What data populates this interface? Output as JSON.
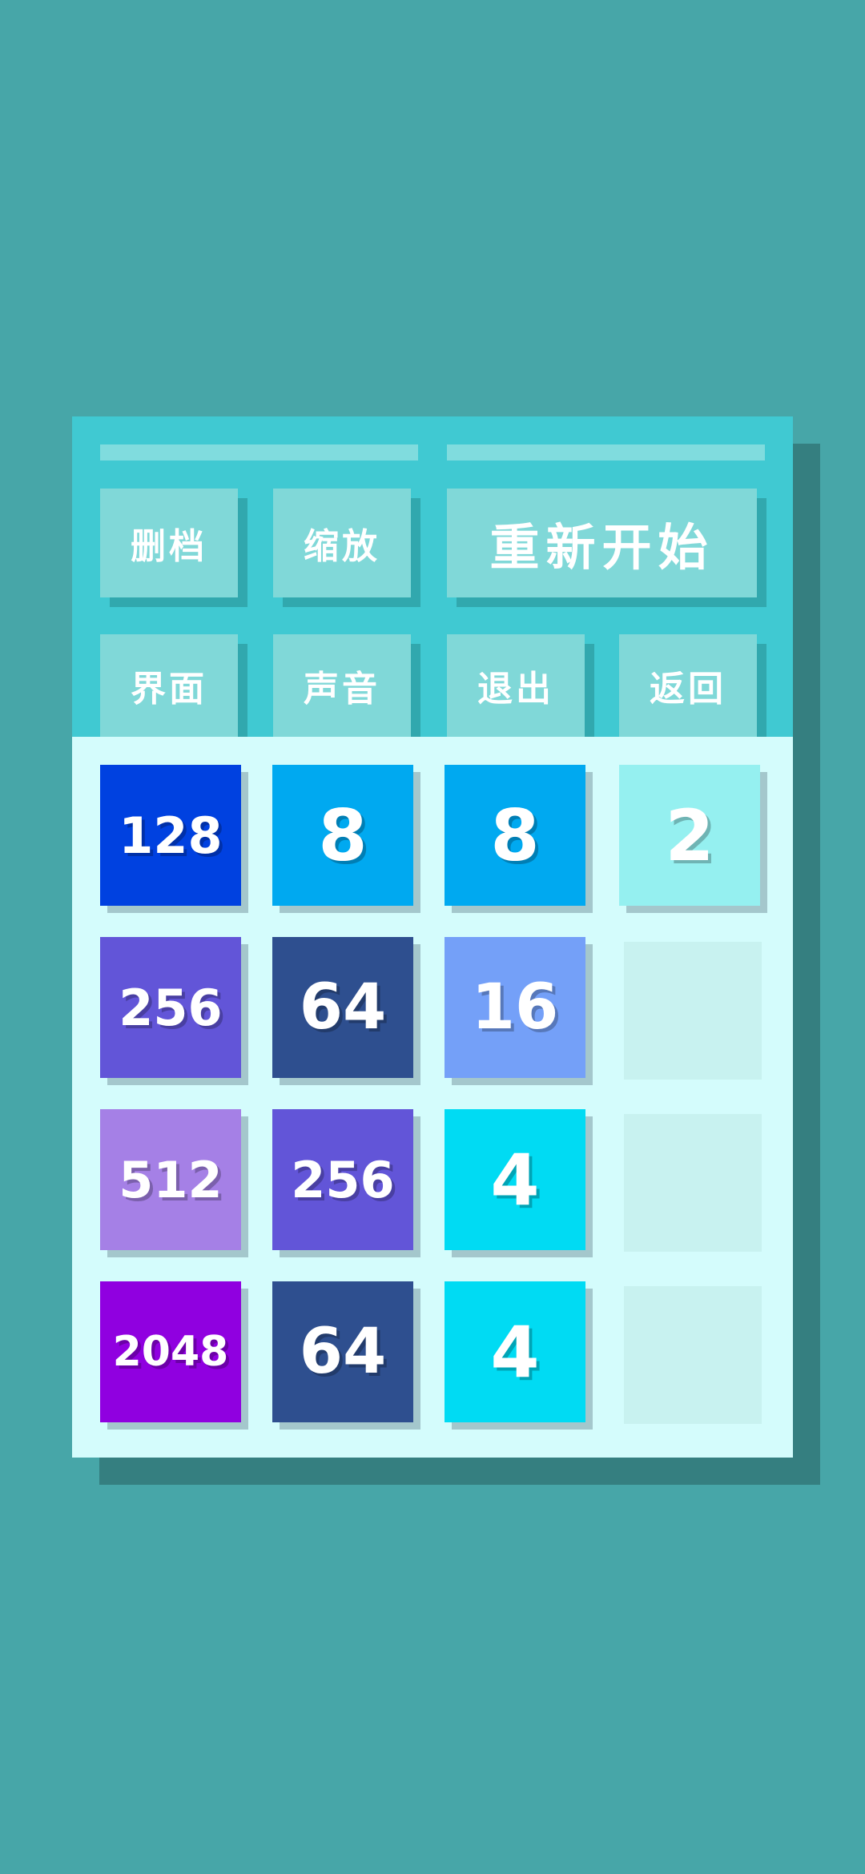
{
  "buttons": {
    "delete_save": "删档",
    "zoom": "缩放",
    "restart": "重新开始",
    "interface": "界面",
    "sound": "声音",
    "exit": "退出",
    "back": "返回"
  },
  "board": {
    "rows": [
      [
        128,
        8,
        8,
        2
      ],
      [
        256,
        64,
        16,
        null
      ],
      [
        512,
        256,
        4,
        null
      ],
      [
        2048,
        64,
        4,
        null
      ]
    ],
    "tile_colors": {
      "2": "#95f0f0",
      "4": "#00dbf3",
      "8": "#00a9f0",
      "16": "#74a0f8",
      "64": "#2e4f8f",
      "128": "#0041e0",
      "256": "#6255d8",
      "512": "#a580e6",
      "2048": "#9000e0"
    }
  },
  "colors": {
    "background": "#47a6a8",
    "panel_top": "#40c9d2",
    "board_bg": "#d4fcfc",
    "empty_cell": "#c8f2f0",
    "button": "#80d8d8"
  }
}
